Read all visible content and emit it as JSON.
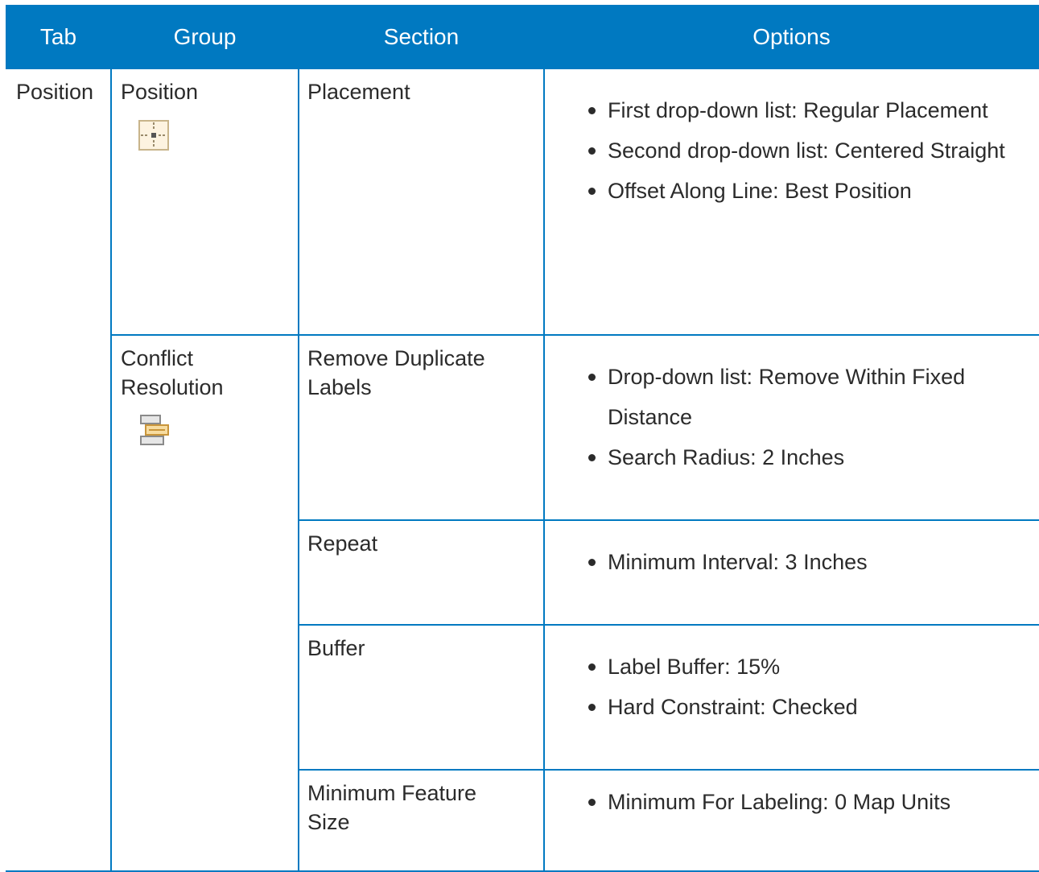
{
  "header": {
    "tab": "Tab",
    "group": "Group",
    "section": "Section",
    "options": "Options"
  },
  "tab_label": "Position",
  "groups": [
    {
      "label": "Position",
      "icon": "label-position-icon",
      "sections": [
        {
          "label": "Placement",
          "options": [
            "First drop-down list: Regular Placement",
            "Second drop-down list: Centered Straight",
            "Offset Along Line: Best Position"
          ]
        }
      ]
    },
    {
      "label": "Conflict Resolution",
      "icon": "conflict-resolution-icon",
      "sections": [
        {
          "label": "Remove Duplicate Labels",
          "options": [
            "Drop-down list: Remove Within Fixed Distance",
            "Search Radius: 2 Inches"
          ]
        },
        {
          "label": "Repeat",
          "options": [
            "Minimum Interval: 3 Inches"
          ]
        },
        {
          "label": "Buffer",
          "options": [
            "Label Buffer: 15%",
            "Hard Constraint: Checked"
          ]
        },
        {
          "label": "Minimum Feature Size",
          "options": [
            "Minimum For Labeling: 0 Map Units"
          ]
        }
      ]
    }
  ],
  "colors": {
    "header_bg": "#0079c1",
    "header_text": "#ffffff",
    "border": "#0079c1",
    "body_text": "#2b2b2b"
  }
}
